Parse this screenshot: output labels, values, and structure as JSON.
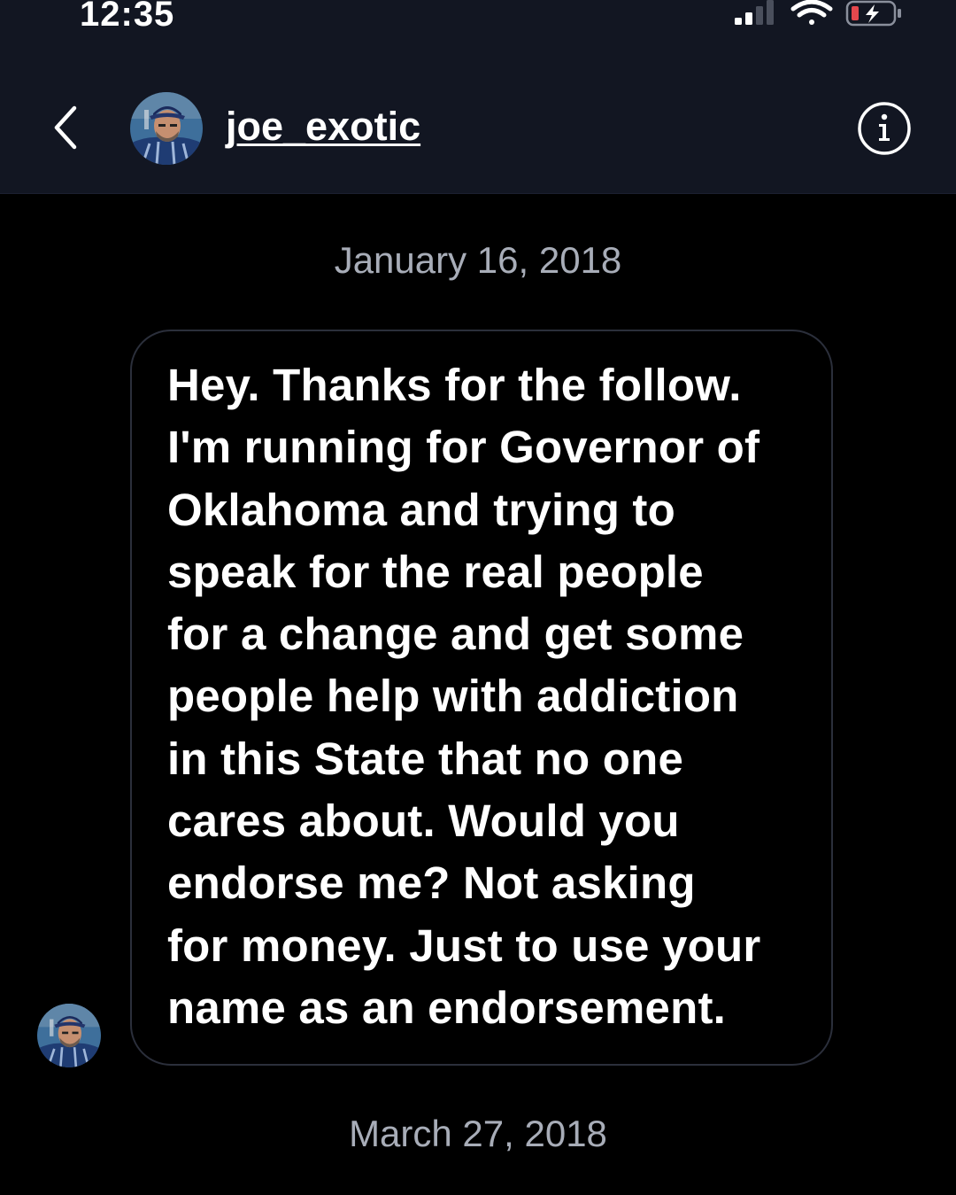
{
  "status_bar": {
    "time": "12:35",
    "icons": [
      "signal-icon",
      "wifi-icon",
      "battery-charging-icon"
    ],
    "battery_color": "#e5484d"
  },
  "header": {
    "back_icon": "chevron-left-icon",
    "username": "joe_exotic",
    "info_icon": "info-icon"
  },
  "thread": {
    "messages": [
      {
        "date": "January 16, 2018",
        "text": "Hey. Thanks for the follow.\nI'm running for Governor of\nOklahoma and trying to\nspeak for the real people\nfor a change and get some\npeople help with addiction\nin this State that no one\ncares about. Would you\nendorse me? Not asking\nfor money. Just to use your\nname as an endorsement."
      }
    ],
    "next_date": "March 27, 2018"
  },
  "colors": {
    "header_bg": "#121622",
    "body_bg": "#000000",
    "date_text": "#a8adb8",
    "bubble_border": "#2b2f3b"
  }
}
